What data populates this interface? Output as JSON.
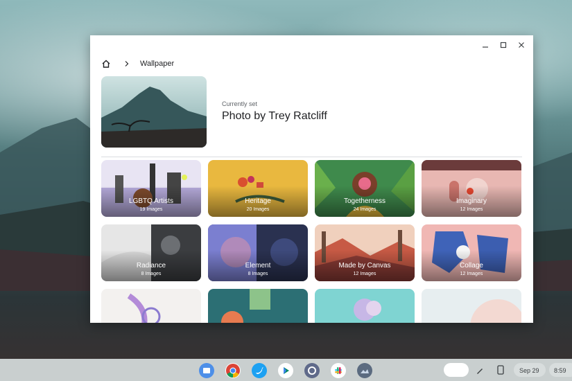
{
  "window": {
    "breadcrumb": {
      "title": "Wallpaper"
    },
    "current": {
      "label": "Currently set",
      "title": "Photo by Trey Ratcliff"
    },
    "collections": [
      {
        "name": "LGBTQ Artists",
        "count": "19 Images"
      },
      {
        "name": "Heritage",
        "count": "20 Images"
      },
      {
        "name": "Togetherness",
        "count": "24 Images"
      },
      {
        "name": "Imaginary",
        "count": "12 Images"
      },
      {
        "name": "Radiance",
        "count": "8 Images"
      },
      {
        "name": "Element",
        "count": "8 Images"
      },
      {
        "name": "Made by Canvas",
        "count": "12 Images"
      },
      {
        "name": "Collage",
        "count": "12 Images"
      },
      {
        "name": "",
        "count": ""
      },
      {
        "name": "",
        "count": ""
      },
      {
        "name": "",
        "count": ""
      },
      {
        "name": "",
        "count": ""
      }
    ]
  },
  "shelf": {
    "apps": [
      "files-icon",
      "chrome-icon",
      "twitter-icon",
      "play-store-icon",
      "settings-icon",
      "slack-icon",
      "wallpaper-app-icon"
    ],
    "date": "Sep 29",
    "time": "8:59"
  },
  "colors": {
    "window_bg": "#ffffff",
    "shelf_bg": "#c9cfcf",
    "text_primary": "#202124",
    "text_secondary": "#5f6368"
  }
}
